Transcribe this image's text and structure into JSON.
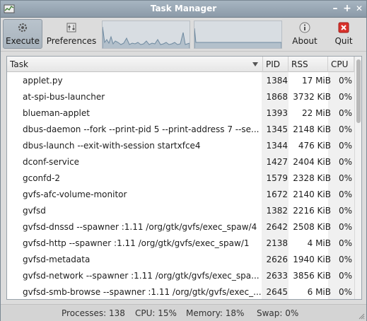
{
  "window": {
    "title": "Task Manager"
  },
  "titlebar": {
    "minimize": "–",
    "maximize": "+",
    "close": "✕"
  },
  "toolbar": {
    "execute_label": "Execute",
    "preferences_label": "Preferences",
    "about_label": "About",
    "quit_label": "Quit"
  },
  "table": {
    "headers": {
      "task": "Task",
      "pid": "PID",
      "rss": "RSS",
      "cpu": "CPU"
    },
    "rows": [
      {
        "task": "applet.py",
        "pid": "1384",
        "rss": "17 MiB",
        "cpu": "0%"
      },
      {
        "task": "at-spi-bus-launcher",
        "pid": "1868",
        "rss": "3732 KiB",
        "cpu": "0%"
      },
      {
        "task": "blueman-applet",
        "pid": "1393",
        "rss": "22 MiB",
        "cpu": "0%"
      },
      {
        "task": "dbus-daemon --fork --print-pid 5 --print-address 7 --se...",
        "pid": "1345",
        "rss": "2148 KiB",
        "cpu": "0%"
      },
      {
        "task": "dbus-launch --exit-with-session startxfce4",
        "pid": "1344",
        "rss": "476 KiB",
        "cpu": "0%"
      },
      {
        "task": "dconf-service",
        "pid": "1427",
        "rss": "2404 KiB",
        "cpu": "0%"
      },
      {
        "task": "gconfd-2",
        "pid": "1579",
        "rss": "2328 KiB",
        "cpu": "0%"
      },
      {
        "task": "gvfs-afc-volume-monitor",
        "pid": "1672",
        "rss": "2140 KiB",
        "cpu": "0%"
      },
      {
        "task": "gvfsd",
        "pid": "1382",
        "rss": "2216 KiB",
        "cpu": "0%"
      },
      {
        "task": "gvfsd-dnssd --spawner :1.11 /org/gtk/gvfs/exec_spaw/4",
        "pid": "2642",
        "rss": "2508 KiB",
        "cpu": "0%"
      },
      {
        "task": "gvfsd-http --spawner :1.11 /org/gtk/gvfs/exec_spaw/1",
        "pid": "2138",
        "rss": "4 MiB",
        "cpu": "0%"
      },
      {
        "task": "gvfsd-metadata",
        "pid": "2626",
        "rss": "1940 KiB",
        "cpu": "0%"
      },
      {
        "task": "gvfsd-network --spawner :1.11 /org/gtk/gvfs/exec_spa...",
        "pid": "2633",
        "rss": "3856 KiB",
        "cpu": "0%"
      },
      {
        "task": "gvfsd-smb-browse --spawner :1.11 /org/gtk/gvfs/exec_...",
        "pid": "2645",
        "rss": "6 MiB",
        "cpu": "0%"
      }
    ]
  },
  "status": {
    "processes": "Processes: 138",
    "cpu": "CPU: 15%",
    "memory": "Memory: 18%",
    "swap": "Swap: 0%"
  },
  "colors": {
    "title_bar": "#98a7b4",
    "quit_icon": "#d9312b",
    "graph_line": "#6f8aa0"
  }
}
